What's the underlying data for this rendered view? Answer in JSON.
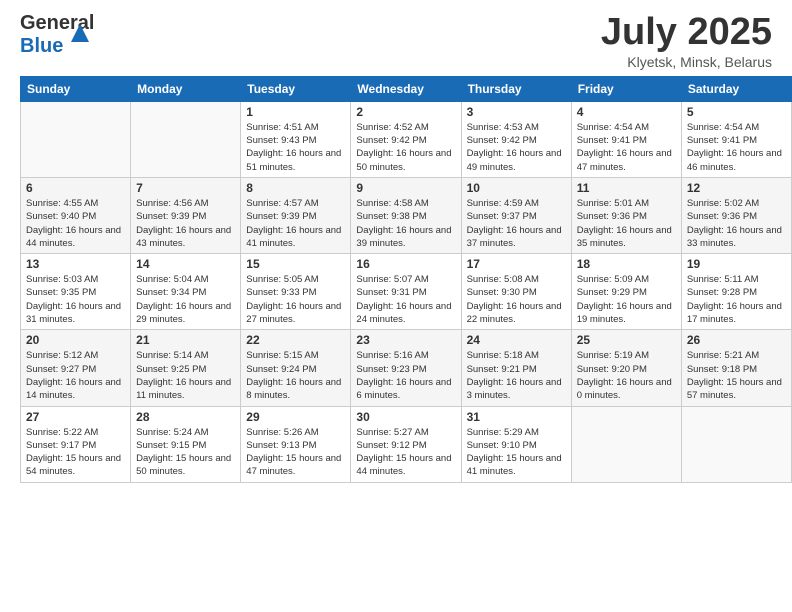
{
  "header": {
    "logo_general": "General",
    "logo_blue": "Blue",
    "title": "July 2025",
    "subtitle": "Klyetsk, Minsk, Belarus"
  },
  "days_of_week": [
    "Sunday",
    "Monday",
    "Tuesday",
    "Wednesday",
    "Thursday",
    "Friday",
    "Saturday"
  ],
  "weeks": [
    [
      {
        "day": "",
        "info": ""
      },
      {
        "day": "",
        "info": ""
      },
      {
        "day": "1",
        "info": "Sunrise: 4:51 AM\nSunset: 9:43 PM\nDaylight: 16 hours and 51 minutes."
      },
      {
        "day": "2",
        "info": "Sunrise: 4:52 AM\nSunset: 9:42 PM\nDaylight: 16 hours and 50 minutes."
      },
      {
        "day": "3",
        "info": "Sunrise: 4:53 AM\nSunset: 9:42 PM\nDaylight: 16 hours and 49 minutes."
      },
      {
        "day": "4",
        "info": "Sunrise: 4:54 AM\nSunset: 9:41 PM\nDaylight: 16 hours and 47 minutes."
      },
      {
        "day": "5",
        "info": "Sunrise: 4:54 AM\nSunset: 9:41 PM\nDaylight: 16 hours and 46 minutes."
      }
    ],
    [
      {
        "day": "6",
        "info": "Sunrise: 4:55 AM\nSunset: 9:40 PM\nDaylight: 16 hours and 44 minutes."
      },
      {
        "day": "7",
        "info": "Sunrise: 4:56 AM\nSunset: 9:39 PM\nDaylight: 16 hours and 43 minutes."
      },
      {
        "day": "8",
        "info": "Sunrise: 4:57 AM\nSunset: 9:39 PM\nDaylight: 16 hours and 41 minutes."
      },
      {
        "day": "9",
        "info": "Sunrise: 4:58 AM\nSunset: 9:38 PM\nDaylight: 16 hours and 39 minutes."
      },
      {
        "day": "10",
        "info": "Sunrise: 4:59 AM\nSunset: 9:37 PM\nDaylight: 16 hours and 37 minutes."
      },
      {
        "day": "11",
        "info": "Sunrise: 5:01 AM\nSunset: 9:36 PM\nDaylight: 16 hours and 35 minutes."
      },
      {
        "day": "12",
        "info": "Sunrise: 5:02 AM\nSunset: 9:36 PM\nDaylight: 16 hours and 33 minutes."
      }
    ],
    [
      {
        "day": "13",
        "info": "Sunrise: 5:03 AM\nSunset: 9:35 PM\nDaylight: 16 hours and 31 minutes."
      },
      {
        "day": "14",
        "info": "Sunrise: 5:04 AM\nSunset: 9:34 PM\nDaylight: 16 hours and 29 minutes."
      },
      {
        "day": "15",
        "info": "Sunrise: 5:05 AM\nSunset: 9:33 PM\nDaylight: 16 hours and 27 minutes."
      },
      {
        "day": "16",
        "info": "Sunrise: 5:07 AM\nSunset: 9:31 PM\nDaylight: 16 hours and 24 minutes."
      },
      {
        "day": "17",
        "info": "Sunrise: 5:08 AM\nSunset: 9:30 PM\nDaylight: 16 hours and 22 minutes."
      },
      {
        "day": "18",
        "info": "Sunrise: 5:09 AM\nSunset: 9:29 PM\nDaylight: 16 hours and 19 minutes."
      },
      {
        "day": "19",
        "info": "Sunrise: 5:11 AM\nSunset: 9:28 PM\nDaylight: 16 hours and 17 minutes."
      }
    ],
    [
      {
        "day": "20",
        "info": "Sunrise: 5:12 AM\nSunset: 9:27 PM\nDaylight: 16 hours and 14 minutes."
      },
      {
        "day": "21",
        "info": "Sunrise: 5:14 AM\nSunset: 9:25 PM\nDaylight: 16 hours and 11 minutes."
      },
      {
        "day": "22",
        "info": "Sunrise: 5:15 AM\nSunset: 9:24 PM\nDaylight: 16 hours and 8 minutes."
      },
      {
        "day": "23",
        "info": "Sunrise: 5:16 AM\nSunset: 9:23 PM\nDaylight: 16 hours and 6 minutes."
      },
      {
        "day": "24",
        "info": "Sunrise: 5:18 AM\nSunset: 9:21 PM\nDaylight: 16 hours and 3 minutes."
      },
      {
        "day": "25",
        "info": "Sunrise: 5:19 AM\nSunset: 9:20 PM\nDaylight: 16 hours and 0 minutes."
      },
      {
        "day": "26",
        "info": "Sunrise: 5:21 AM\nSunset: 9:18 PM\nDaylight: 15 hours and 57 minutes."
      }
    ],
    [
      {
        "day": "27",
        "info": "Sunrise: 5:22 AM\nSunset: 9:17 PM\nDaylight: 15 hours and 54 minutes."
      },
      {
        "day": "28",
        "info": "Sunrise: 5:24 AM\nSunset: 9:15 PM\nDaylight: 15 hours and 50 minutes."
      },
      {
        "day": "29",
        "info": "Sunrise: 5:26 AM\nSunset: 9:13 PM\nDaylight: 15 hours and 47 minutes."
      },
      {
        "day": "30",
        "info": "Sunrise: 5:27 AM\nSunset: 9:12 PM\nDaylight: 15 hours and 44 minutes."
      },
      {
        "day": "31",
        "info": "Sunrise: 5:29 AM\nSunset: 9:10 PM\nDaylight: 15 hours and 41 minutes."
      },
      {
        "day": "",
        "info": ""
      },
      {
        "day": "",
        "info": ""
      }
    ]
  ]
}
